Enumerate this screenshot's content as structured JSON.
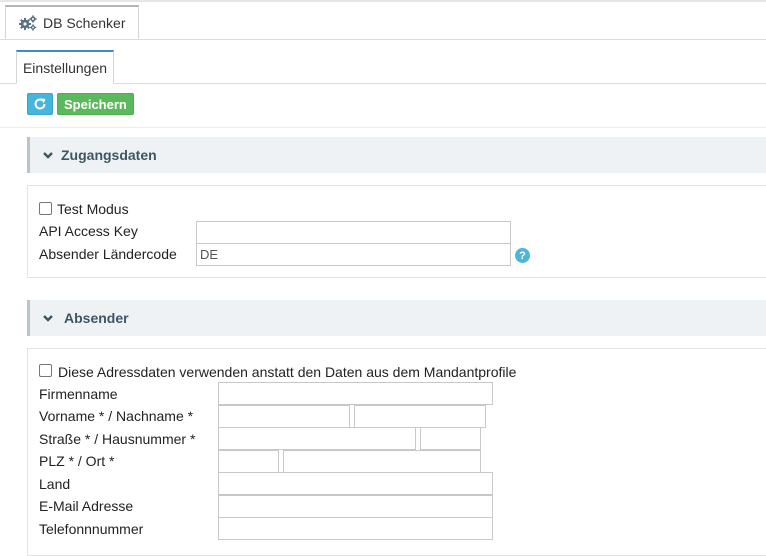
{
  "main_tab": {
    "label": "DB Schenker",
    "icon": "gears-icon"
  },
  "sub_tab": {
    "label": "Einstellungen"
  },
  "toolbar": {
    "refresh_icon": "refresh-icon",
    "save_label": "Speichern"
  },
  "sections": {
    "zugang": {
      "title": "Zugangsdaten",
      "test_mode_label": "Test Modus",
      "test_mode_checked": false,
      "api_key_label": "API Access Key",
      "api_key_value": "",
      "country_label": "Absender Ländercode",
      "country_value": "DE",
      "help_icon": "question-icon"
    },
    "absender": {
      "title": "Absender",
      "use_address_label": "Diese Adressdaten verwenden anstatt den Daten aus dem Mandantprofile",
      "use_address_checked": false,
      "company_label": "Firmenname",
      "name_label": "Vorname * / Nachname *",
      "street_label": "Straße * / Hausnummer *",
      "zip_city_label": "PLZ * / Ort *",
      "country_label": "Land",
      "email_label": "E-Mail Adresse",
      "phone_label": "Telefonnnummer"
    }
  },
  "colors": {
    "accent_blue": "#45b5dc",
    "save_green": "#5cb85c",
    "section_bg": "#eef2f4"
  }
}
